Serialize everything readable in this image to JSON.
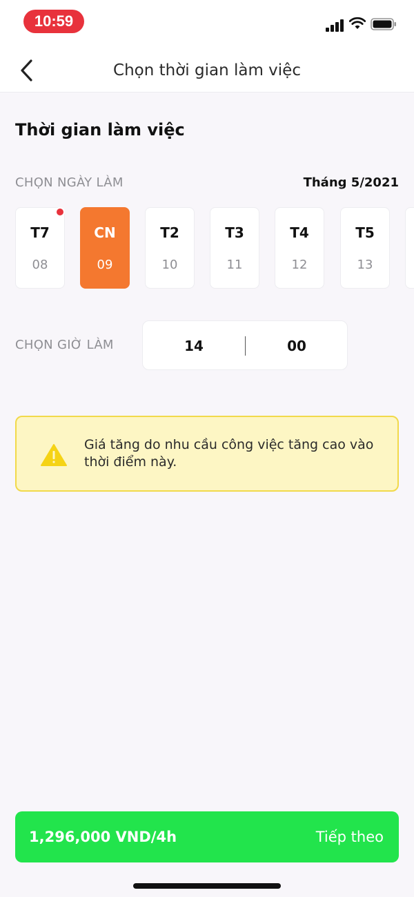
{
  "status_bar": {
    "time": "10:59"
  },
  "header": {
    "title": "Chọn thời gian làm việc",
    "back_icon": "chevron-left-icon"
  },
  "section_title": "Thời gian làm việc",
  "day_picker": {
    "label": "CHỌN NGÀY LÀM",
    "month": "Tháng 5/2021",
    "days": [
      {
        "name": "T7",
        "date": "08",
        "selected": false,
        "has_dot": true
      },
      {
        "name": "CN",
        "date": "09",
        "selected": true,
        "has_dot": false
      },
      {
        "name": "T2",
        "date": "10",
        "selected": false,
        "has_dot": false
      },
      {
        "name": "T3",
        "date": "11",
        "selected": false,
        "has_dot": false
      },
      {
        "name": "T4",
        "date": "12",
        "selected": false,
        "has_dot": false
      },
      {
        "name": "T5",
        "date": "13",
        "selected": false,
        "has_dot": false
      }
    ]
  },
  "time_picker": {
    "label": "CHỌN GIỜ LÀM",
    "hour": "14",
    "minute": "00"
  },
  "warning": {
    "text": "Giá tăng do nhu cầu công việc tăng cao vào thời điểm này.",
    "icon": "warning-triangle-icon"
  },
  "footer": {
    "price": "1,296,000 VND/4h",
    "next_label": "Tiếp theo"
  },
  "colors": {
    "accent_orange": "#f4782f",
    "button_green": "#22e44c",
    "warning_bg": "#fdf6c4",
    "time_pill": "#e8323c"
  }
}
